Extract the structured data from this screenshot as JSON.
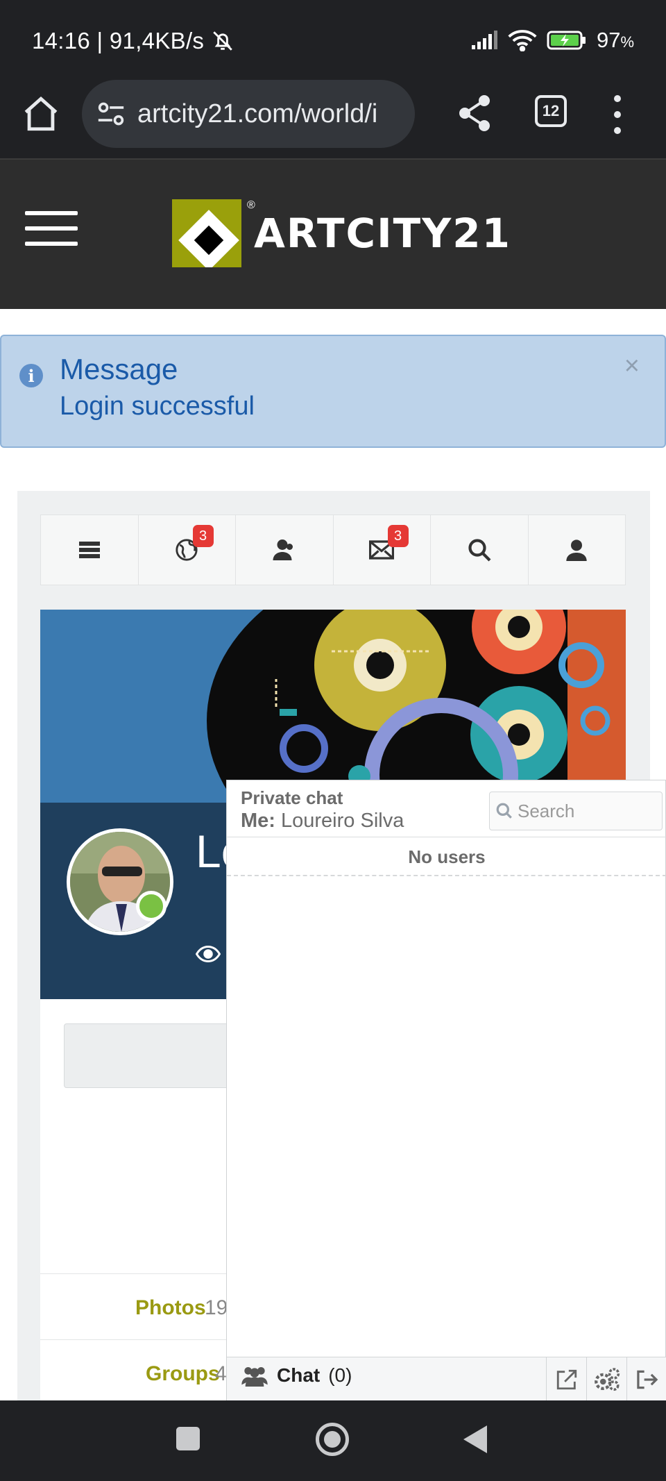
{
  "status_bar": {
    "time_speed": "14:16 | 91,4KB/s",
    "battery": "97",
    "battery_unit": "%",
    "icons": [
      "bell-off-icon",
      "signal-icon",
      "wifi-icon",
      "battery-icon"
    ]
  },
  "browser": {
    "url": "artcity21.com/world/i",
    "tab_count": "12",
    "icons": [
      "home-icon",
      "site-settings-icon",
      "share-icon",
      "tabs-icon",
      "more-icon"
    ]
  },
  "site": {
    "logo_text": "ARTCITY21",
    "logo_reg": "®"
  },
  "alert": {
    "title": "Message",
    "text": "Login successful",
    "close": "×",
    "info_glyph": "i"
  },
  "nav": {
    "notifications_badge": "3",
    "messages_badge": "3",
    "icons": [
      "menu-icon",
      "globe-icon",
      "friends-icon",
      "mail-icon",
      "search-icon",
      "user-icon"
    ]
  },
  "profile": {
    "name_visible": "Lo",
    "online": true
  },
  "stats": [
    {
      "label": "Photos",
      "count": "19"
    },
    {
      "label": "Groups",
      "count": "4"
    }
  ],
  "chat": {
    "title": "Private chat",
    "me_label": "Me:",
    "me_name": "Loureiro Silva",
    "search_placeholder": "Search",
    "no_users": "No users",
    "bottom_label": "Chat",
    "bottom_count": "(0)"
  },
  "colors": {
    "header_bg": "#2d2d2d",
    "alert_bg": "#bdd3ea",
    "alert_text": "#1a5aa8",
    "logo_green": "#9aa00b",
    "stat_label": "#9a9a12",
    "badge": "#e53935",
    "online": "#7ac143"
  }
}
